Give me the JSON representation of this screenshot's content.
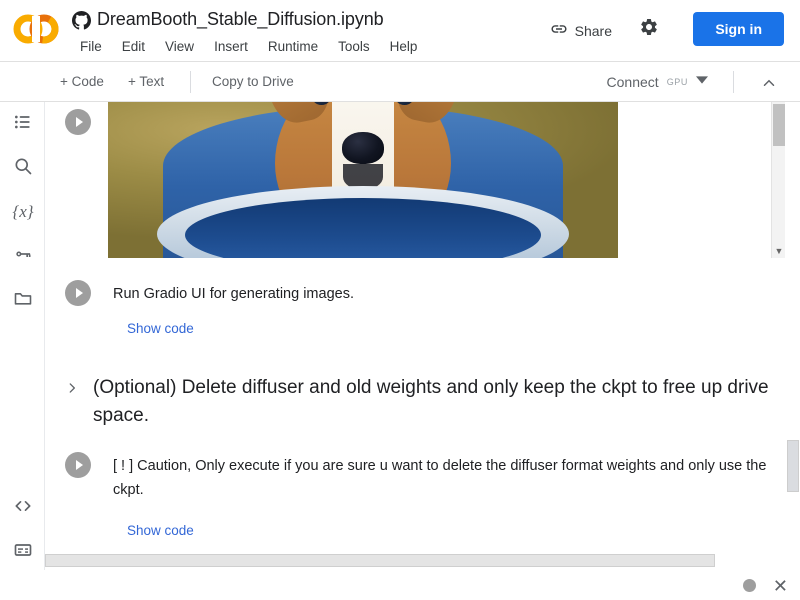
{
  "app": {
    "logo_name": "colab-logo",
    "source_icon": "github-icon",
    "doc_title": "DreamBooth_Stable_Diffusion.ipynb"
  },
  "menubar": {
    "items": [
      {
        "label": "File"
      },
      {
        "label": "Edit"
      },
      {
        "label": "View"
      },
      {
        "label": "Insert"
      },
      {
        "label": "Runtime"
      },
      {
        "label": "Tools"
      },
      {
        "label": "Help"
      }
    ]
  },
  "header_actions": {
    "share_label": "Share",
    "share_icon": "link-icon",
    "settings_icon": "gear-icon",
    "signin_label": "Sign in",
    "accent_color": "#1a73e8"
  },
  "toolbar": {
    "add_code_label": "+ Code",
    "add_text_label": "+ Text",
    "copy_to_drive_label": "Copy to Drive",
    "connect_label": "Connect",
    "connect_badge": "GPU",
    "connect_caret_icon": "chevron-down-icon",
    "collapse_icon": "chevron-up-icon"
  },
  "sidebar": {
    "items": [
      {
        "name": "table-of-contents",
        "icon": "list-icon"
      },
      {
        "name": "search",
        "icon": "search-icon"
      },
      {
        "name": "variables",
        "icon": "variables-icon",
        "glyph": "{x}"
      },
      {
        "name": "secrets",
        "icon": "key-icon"
      },
      {
        "name": "files",
        "icon": "folder-icon"
      }
    ],
    "bottom_items": [
      {
        "name": "code-snippets",
        "icon": "code-brackets-icon",
        "glyph": "<>"
      },
      {
        "name": "terminal",
        "icon": "terminal-icon"
      }
    ]
  },
  "notebook": {
    "cells": [
      {
        "type": "output-image",
        "run_icon": "play-icon",
        "image_alt": "generated corgi puppy sitting in a blue basin"
      },
      {
        "type": "markdown-run",
        "run_icon": "play-icon",
        "text": "Run Gradio UI for generating images.",
        "show_code_label": "Show code"
      },
      {
        "type": "section-heading",
        "chevron_icon": "chevron-right-icon",
        "text": "(Optional) Delete diffuser and old weights and only keep the ckpt to free up drive space."
      },
      {
        "type": "markdown-run",
        "run_icon": "play-icon",
        "text": "[ ! ] Caution, Only execute if you are sure u want to delete the diffuser format weights and only use the ckpt.",
        "show_code_label": "Show code"
      }
    ]
  },
  "scrollbars": {
    "output_scroll_arrow": "▼"
  },
  "bottombar": {
    "status_icon": "status-dot-icon",
    "close_icon": "close-icon",
    "close_glyph": "✕"
  }
}
